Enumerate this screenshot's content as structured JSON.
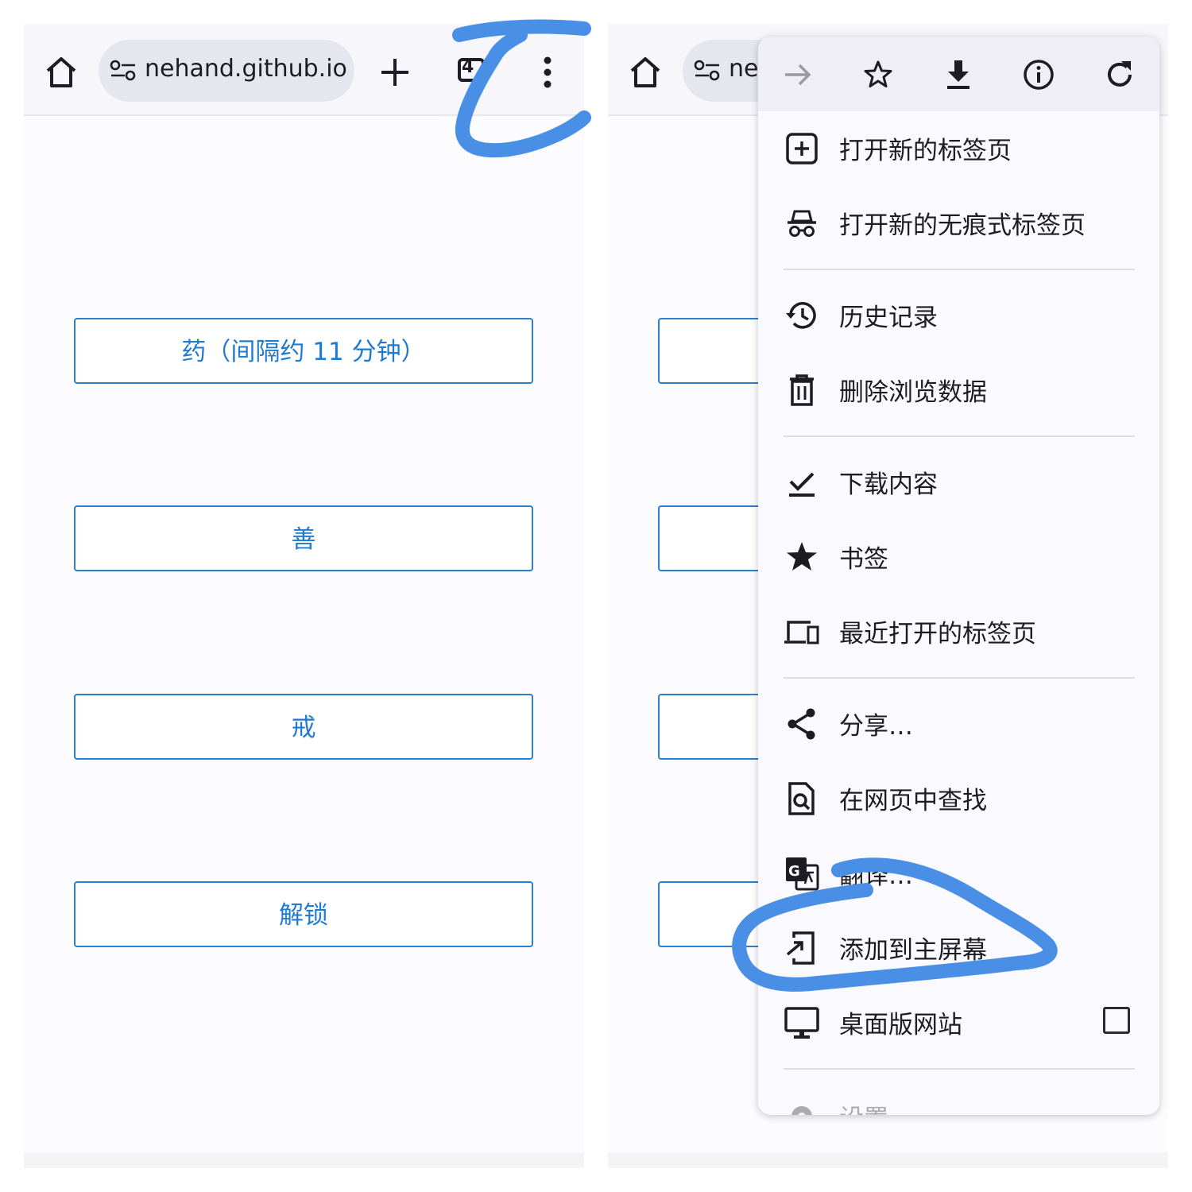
{
  "left_panel": {
    "url": "nehand.github.io",
    "tab_count": "4",
    "buttons": [
      "药（间隔约 11 分钟）",
      "善",
      "戒",
      "解锁"
    ]
  },
  "right_panel": {
    "url_fragment": "ne"
  },
  "menu": {
    "top_icons": [
      "forward-icon",
      "bookmark-star-icon",
      "download-icon",
      "info-icon",
      "reload-icon"
    ],
    "items": [
      {
        "label": "打开新的标签页",
        "icon": "new-tab-icon"
      },
      {
        "label": "打开新的无痕式标签页",
        "icon": "incognito-icon"
      },
      {
        "label": "历史记录",
        "icon": "history-icon"
      },
      {
        "label": "删除浏览数据",
        "icon": "trash-icon"
      },
      {
        "label": "下载内容",
        "icon": "downloads-check-icon"
      },
      {
        "label": "书签",
        "icon": "star-icon"
      },
      {
        "label": "最近打开的标签页",
        "icon": "devices-icon"
      },
      {
        "label": "分享…",
        "icon": "share-icon"
      },
      {
        "label": "在网页中查找",
        "icon": "find-in-page-icon"
      },
      {
        "label": "翻译…",
        "icon": "translate-icon"
      },
      {
        "label": "添加到主屏幕",
        "icon": "add-to-home-icon"
      },
      {
        "label": "桌面版网站",
        "icon": "desktop-icon",
        "checked": false
      },
      {
        "label": "设置",
        "icon": "gear-icon"
      }
    ]
  },
  "colors": {
    "accent": "#1f7bd0",
    "annotation_stroke": "#4a8fe6",
    "toolbar_bg": "#f7f7fb",
    "menu_bg": "#fafafe"
  }
}
